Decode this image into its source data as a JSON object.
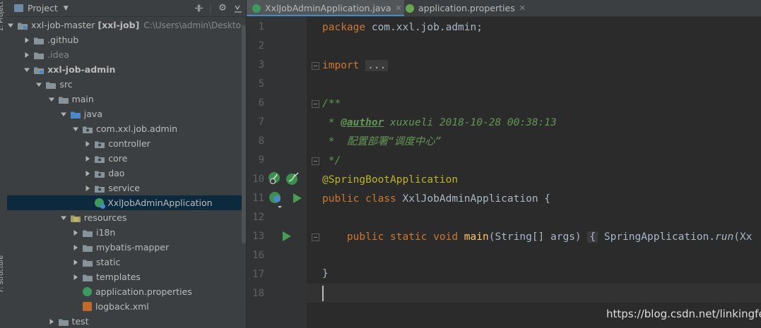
{
  "side_strip": {
    "top_label": "1: Project",
    "bottom_label": "7: Structure"
  },
  "project_panel": {
    "title": "Project",
    "tree": [
      {
        "label": "xxl-job-master",
        "module": "[xxl-job]",
        "path": "C:\\Users\\admin\\Desktop\\",
        "depth": 0,
        "expanded": true,
        "icon": "module-folder-icon"
      },
      {
        "label": ".github",
        "depth": 1,
        "expanded": false,
        "icon": "folder-icon"
      },
      {
        "label": ".idea",
        "depth": 1,
        "expanded": false,
        "icon": "folder-icon",
        "muted": true
      },
      {
        "label": "xxl-job-admin",
        "depth": 1,
        "expanded": true,
        "icon": "module-folder-icon",
        "bold": true
      },
      {
        "label": "src",
        "depth": 2,
        "expanded": true,
        "icon": "folder-icon"
      },
      {
        "label": "main",
        "depth": 3,
        "expanded": true,
        "icon": "folder-icon"
      },
      {
        "label": "java",
        "depth": 4,
        "expanded": true,
        "icon": "source-folder-icon"
      },
      {
        "label": "com.xxl.job.admin",
        "depth": 5,
        "expanded": true,
        "icon": "package-icon"
      },
      {
        "label": "controller",
        "depth": 6,
        "expanded": false,
        "icon": "package-icon"
      },
      {
        "label": "core",
        "depth": 6,
        "expanded": false,
        "icon": "package-icon"
      },
      {
        "label": "dao",
        "depth": 6,
        "expanded": false,
        "icon": "package-icon"
      },
      {
        "label": "service",
        "depth": 6,
        "expanded": false,
        "icon": "package-icon"
      },
      {
        "label": "XxlJobAdminApplication",
        "depth": 6,
        "leaf": true,
        "icon": "spring-class-icon",
        "selected": true
      },
      {
        "label": "resources",
        "depth": 4,
        "expanded": true,
        "icon": "resources-folder-icon"
      },
      {
        "label": "i18n",
        "depth": 5,
        "expanded": false,
        "icon": "folder-icon"
      },
      {
        "label": "mybatis-mapper",
        "depth": 5,
        "expanded": false,
        "icon": "folder-icon"
      },
      {
        "label": "static",
        "depth": 5,
        "expanded": false,
        "icon": "folder-icon"
      },
      {
        "label": "templates",
        "depth": 5,
        "expanded": false,
        "icon": "folder-icon"
      },
      {
        "label": "application.properties",
        "depth": 5,
        "leaf": true,
        "icon": "spring-properties-icon"
      },
      {
        "label": "logback.xml",
        "depth": 5,
        "leaf": true,
        "icon": "xml-file-icon"
      },
      {
        "label": "test",
        "depth": 3,
        "expanded": false,
        "icon": "folder-icon"
      }
    ]
  },
  "tabs": [
    {
      "label": "XxlJobAdminApplication.java",
      "active": true
    },
    {
      "label": "application.properties",
      "active": false
    }
  ],
  "editor": {
    "line_numbers": [
      "1",
      "2",
      "3",
      "5",
      "6",
      "7",
      "8",
      "9",
      "10",
      "11",
      "12",
      "13",
      "16",
      "17",
      "18"
    ],
    "lines": {
      "l1": [
        "package",
        " com.xxl.job.admin;"
      ],
      "l3": [
        "import",
        " ",
        "..."
      ],
      "l6": "/**",
      "l7": [
        " * ",
        "@author",
        " xuxueli 2018-10-28 00:38:13"
      ],
      "l8": " *  配置部署“调度中心”",
      "l9": " */",
      "l10": "@SpringBootApplication",
      "l11": [
        "public class",
        " XxlJobAdminApplication {"
      ],
      "l13": [
        "    ",
        "public static void",
        " ",
        "main",
        "(String[] args) ",
        "{",
        " SpringApplication.",
        "run",
        "(Xx"
      ],
      "l17": "}"
    }
  },
  "watermark": "https://blog.csdn.net/linkingfei",
  "colors": {
    "keyword": "#cc7832",
    "comment": "#629755",
    "annotation": "#bbb529",
    "method": "#ffc66d",
    "text": "#a9b7c6",
    "selection": "#0d293e"
  }
}
